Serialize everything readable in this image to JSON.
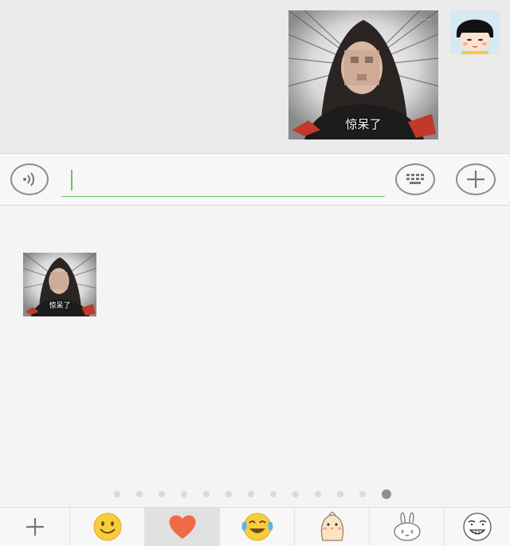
{
  "chat": {
    "sticker_caption": "惊呆了",
    "sticker_watermark": "····"
  },
  "panel": {
    "sticker_caption": "惊呆了",
    "page_count": 13,
    "active_page": 13
  },
  "tabbar": {
    "tabs": [
      {
        "icon": "plus-icon"
      },
      {
        "icon": "smiley-emoji-icon"
      },
      {
        "icon": "heart-icon",
        "selected": true
      },
      {
        "icon": "laughing-crying-emoji-icon"
      },
      {
        "icon": "chick-sticker-icon"
      },
      {
        "icon": "bunny-sticker-icon"
      },
      {
        "icon": "meme-face-sticker-icon"
      }
    ]
  },
  "colors": {
    "accent_green": "#6cc070",
    "heart": "#f06a47",
    "emoji_yellow": "#f7cd3c"
  }
}
